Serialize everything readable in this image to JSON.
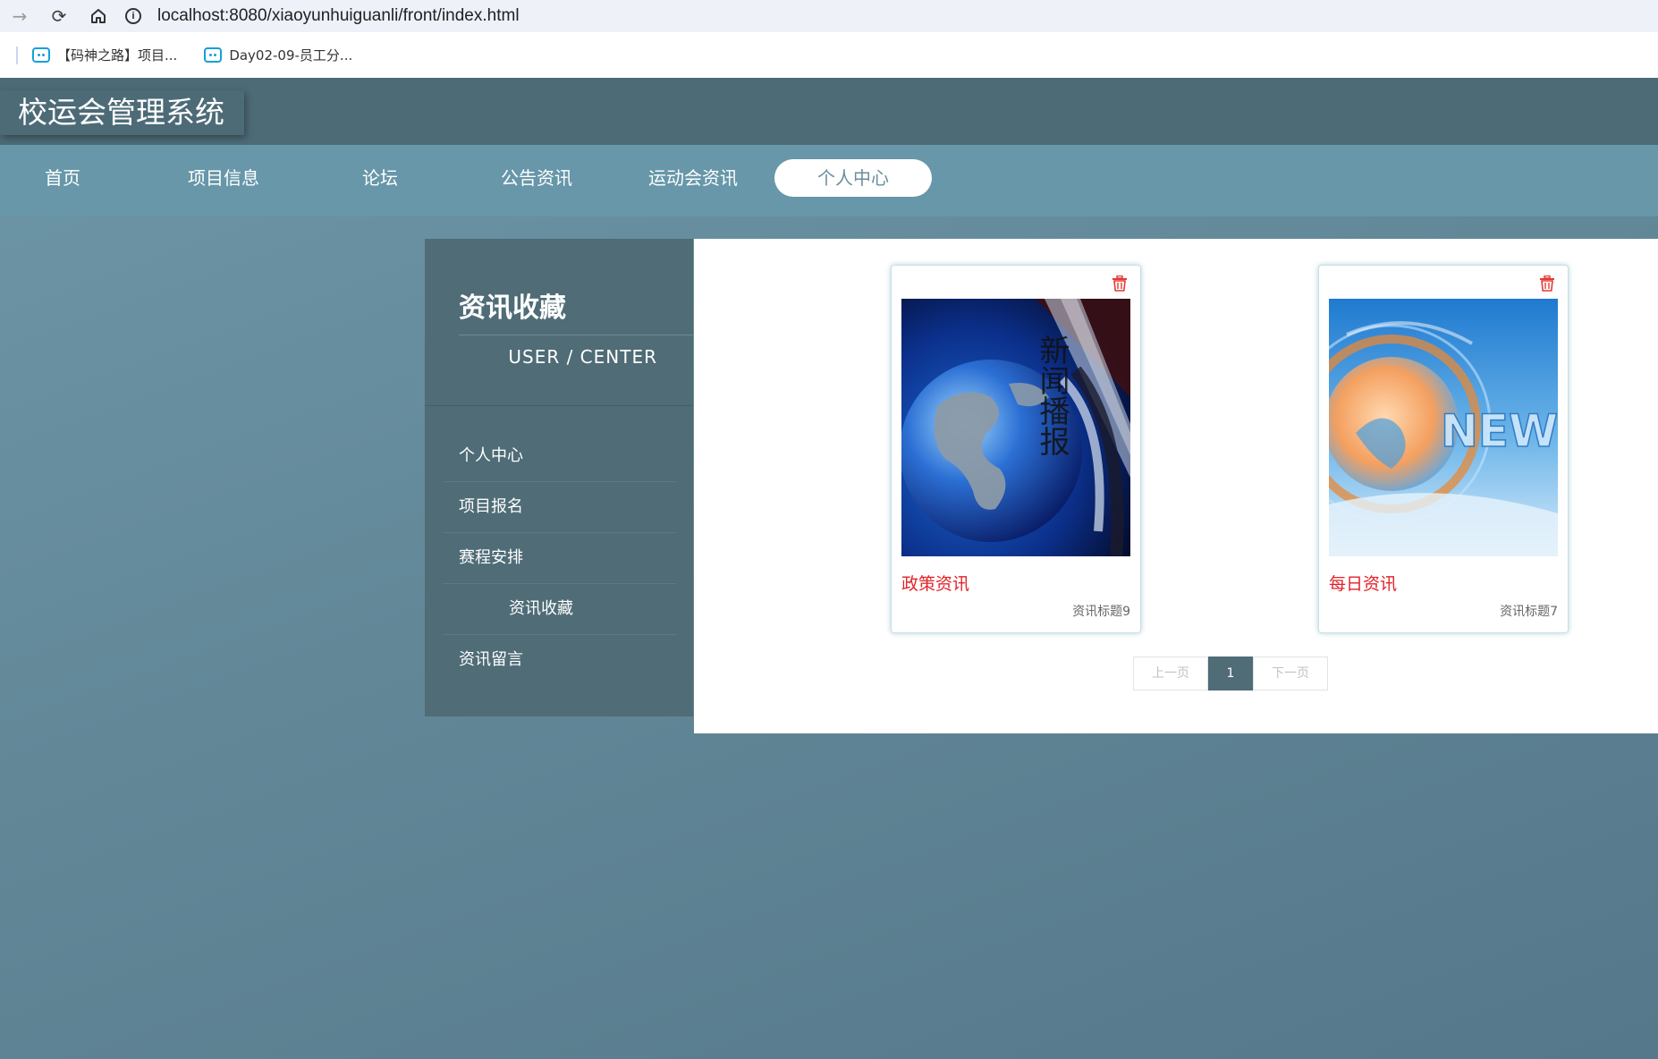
{
  "browser": {
    "url": "localhost:8080/xiaoyunhuiguanli/front/index.html",
    "bookmarks": [
      {
        "label": "【码神之路】项目..."
      },
      {
        "label": "Day02-09-员工分..."
      }
    ]
  },
  "site": {
    "title": "校运会管理系统",
    "nav": [
      {
        "label": "首页"
      },
      {
        "label": "项目信息"
      },
      {
        "label": "论坛"
      },
      {
        "label": "公告资讯"
      },
      {
        "label": "运动会资讯"
      },
      {
        "label": "个人中心"
      }
    ],
    "active_nav": "个人中心"
  },
  "sidebar": {
    "title": "资讯收藏",
    "subtitle": "USER / CENTER",
    "items": [
      {
        "label": "个人中心"
      },
      {
        "label": "项目报名"
      },
      {
        "label": "赛程安排"
      },
      {
        "label": "资讯收藏"
      },
      {
        "label": "资讯留言"
      }
    ],
    "active_item": "资讯收藏"
  },
  "cards": [
    {
      "title": "政策资讯",
      "subtitle": "资讯标题9",
      "image": "globe-news-broadcast-image",
      "image_text": "新闻播报"
    },
    {
      "title": "每日资讯",
      "subtitle": "资讯标题7",
      "image": "globe-news-banner-image",
      "image_text": "NEWS"
    }
  ],
  "pagination": {
    "prev": "上一页",
    "current": "1",
    "next": "下一页"
  },
  "colors": {
    "header": "#4d6b77",
    "nav": "#6797a9",
    "sidebar": "#4f6c77",
    "card_title": "#e1222a",
    "pager_active": "#4f6c77"
  }
}
